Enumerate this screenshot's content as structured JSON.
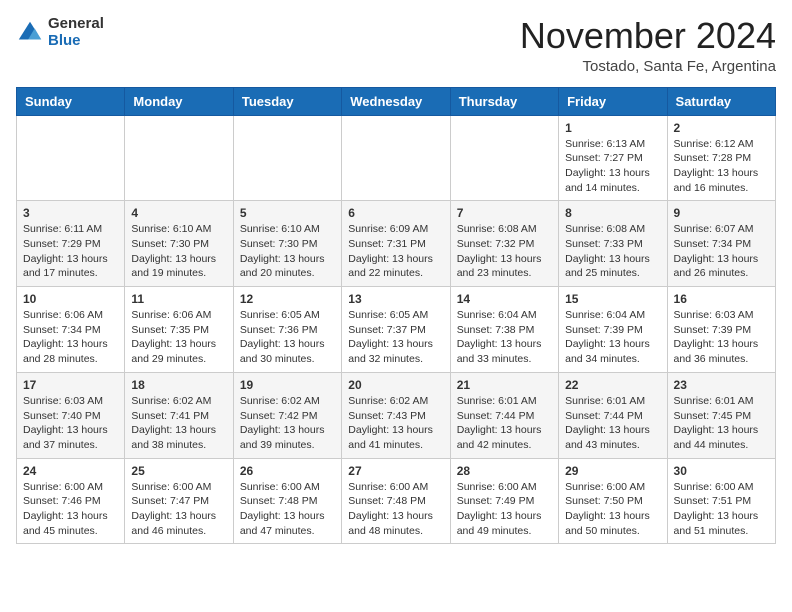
{
  "logo": {
    "general": "General",
    "blue": "Blue"
  },
  "title": "November 2024",
  "location": "Tostado, Santa Fe, Argentina",
  "days_of_week": [
    "Sunday",
    "Monday",
    "Tuesday",
    "Wednesday",
    "Thursday",
    "Friday",
    "Saturday"
  ],
  "weeks": [
    [
      {
        "day": "",
        "info": ""
      },
      {
        "day": "",
        "info": ""
      },
      {
        "day": "",
        "info": ""
      },
      {
        "day": "",
        "info": ""
      },
      {
        "day": "",
        "info": ""
      },
      {
        "day": "1",
        "info": "Sunrise: 6:13 AM\nSunset: 7:27 PM\nDaylight: 13 hours\nand 14 minutes."
      },
      {
        "day": "2",
        "info": "Sunrise: 6:12 AM\nSunset: 7:28 PM\nDaylight: 13 hours\nand 16 minutes."
      }
    ],
    [
      {
        "day": "3",
        "info": "Sunrise: 6:11 AM\nSunset: 7:29 PM\nDaylight: 13 hours\nand 17 minutes."
      },
      {
        "day": "4",
        "info": "Sunrise: 6:10 AM\nSunset: 7:30 PM\nDaylight: 13 hours\nand 19 minutes."
      },
      {
        "day": "5",
        "info": "Sunrise: 6:10 AM\nSunset: 7:30 PM\nDaylight: 13 hours\nand 20 minutes."
      },
      {
        "day": "6",
        "info": "Sunrise: 6:09 AM\nSunset: 7:31 PM\nDaylight: 13 hours\nand 22 minutes."
      },
      {
        "day": "7",
        "info": "Sunrise: 6:08 AM\nSunset: 7:32 PM\nDaylight: 13 hours\nand 23 minutes."
      },
      {
        "day": "8",
        "info": "Sunrise: 6:08 AM\nSunset: 7:33 PM\nDaylight: 13 hours\nand 25 minutes."
      },
      {
        "day": "9",
        "info": "Sunrise: 6:07 AM\nSunset: 7:34 PM\nDaylight: 13 hours\nand 26 minutes."
      }
    ],
    [
      {
        "day": "10",
        "info": "Sunrise: 6:06 AM\nSunset: 7:34 PM\nDaylight: 13 hours\nand 28 minutes."
      },
      {
        "day": "11",
        "info": "Sunrise: 6:06 AM\nSunset: 7:35 PM\nDaylight: 13 hours\nand 29 minutes."
      },
      {
        "day": "12",
        "info": "Sunrise: 6:05 AM\nSunset: 7:36 PM\nDaylight: 13 hours\nand 30 minutes."
      },
      {
        "day": "13",
        "info": "Sunrise: 6:05 AM\nSunset: 7:37 PM\nDaylight: 13 hours\nand 32 minutes."
      },
      {
        "day": "14",
        "info": "Sunrise: 6:04 AM\nSunset: 7:38 PM\nDaylight: 13 hours\nand 33 minutes."
      },
      {
        "day": "15",
        "info": "Sunrise: 6:04 AM\nSunset: 7:39 PM\nDaylight: 13 hours\nand 34 minutes."
      },
      {
        "day": "16",
        "info": "Sunrise: 6:03 AM\nSunset: 7:39 PM\nDaylight: 13 hours\nand 36 minutes."
      }
    ],
    [
      {
        "day": "17",
        "info": "Sunrise: 6:03 AM\nSunset: 7:40 PM\nDaylight: 13 hours\nand 37 minutes."
      },
      {
        "day": "18",
        "info": "Sunrise: 6:02 AM\nSunset: 7:41 PM\nDaylight: 13 hours\nand 38 minutes."
      },
      {
        "day": "19",
        "info": "Sunrise: 6:02 AM\nSunset: 7:42 PM\nDaylight: 13 hours\nand 39 minutes."
      },
      {
        "day": "20",
        "info": "Sunrise: 6:02 AM\nSunset: 7:43 PM\nDaylight: 13 hours\nand 41 minutes."
      },
      {
        "day": "21",
        "info": "Sunrise: 6:01 AM\nSunset: 7:44 PM\nDaylight: 13 hours\nand 42 minutes."
      },
      {
        "day": "22",
        "info": "Sunrise: 6:01 AM\nSunset: 7:44 PM\nDaylight: 13 hours\nand 43 minutes."
      },
      {
        "day": "23",
        "info": "Sunrise: 6:01 AM\nSunset: 7:45 PM\nDaylight: 13 hours\nand 44 minutes."
      }
    ],
    [
      {
        "day": "24",
        "info": "Sunrise: 6:00 AM\nSunset: 7:46 PM\nDaylight: 13 hours\nand 45 minutes."
      },
      {
        "day": "25",
        "info": "Sunrise: 6:00 AM\nSunset: 7:47 PM\nDaylight: 13 hours\nand 46 minutes."
      },
      {
        "day": "26",
        "info": "Sunrise: 6:00 AM\nSunset: 7:48 PM\nDaylight: 13 hours\nand 47 minutes."
      },
      {
        "day": "27",
        "info": "Sunrise: 6:00 AM\nSunset: 7:48 PM\nDaylight: 13 hours\nand 48 minutes."
      },
      {
        "day": "28",
        "info": "Sunrise: 6:00 AM\nSunset: 7:49 PM\nDaylight: 13 hours\nand 49 minutes."
      },
      {
        "day": "29",
        "info": "Sunrise: 6:00 AM\nSunset: 7:50 PM\nDaylight: 13 hours\nand 50 minutes."
      },
      {
        "day": "30",
        "info": "Sunrise: 6:00 AM\nSunset: 7:51 PM\nDaylight: 13 hours\nand 51 minutes."
      }
    ]
  ]
}
